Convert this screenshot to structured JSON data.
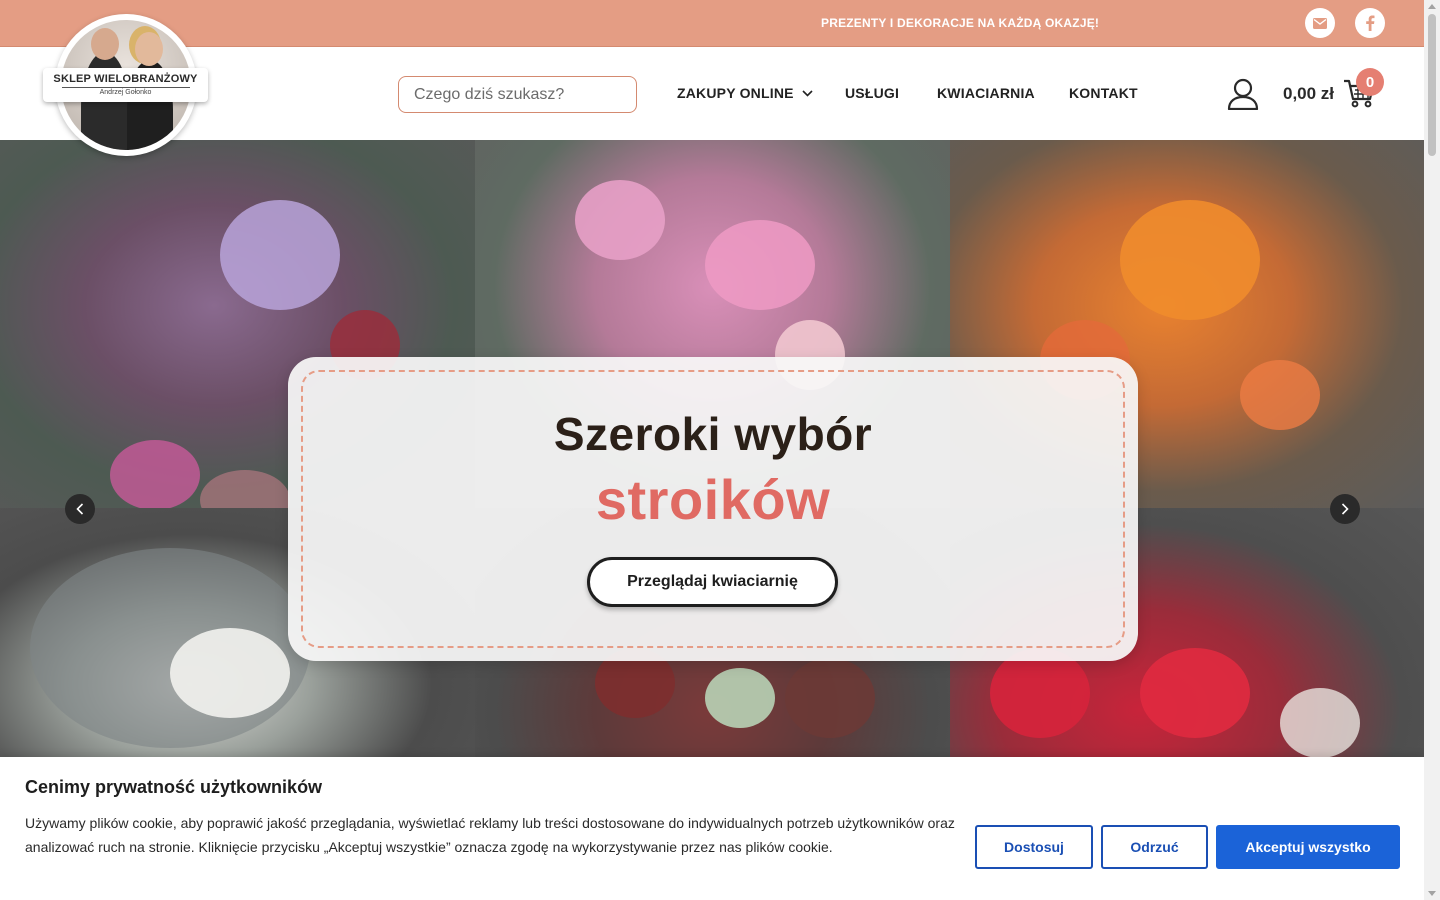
{
  "topbar": {
    "text": "PREZENTY I DEKORACJE NA KAŻDĄ OKAZJĘ!",
    "background": "#e49d84",
    "social": [
      {
        "icon": "mail-icon"
      },
      {
        "icon": "facebook-icon"
      }
    ]
  },
  "logo": {
    "title": "SKLEP WIELOBRANŻOWY",
    "subtitle": "Andrzej Gołonko"
  },
  "search": {
    "placeholder": "Czego dziś szukasz?"
  },
  "nav": {
    "items": [
      {
        "label": "ZAKUPY ONLINE",
        "has_dropdown": true
      },
      {
        "label": "USŁUGI"
      },
      {
        "label": "KWIACIARNIA"
      },
      {
        "label": "KONTAKT"
      }
    ]
  },
  "cart": {
    "total": "0,00 zł",
    "count": "0",
    "badge_color": "#e57f72"
  },
  "hero": {
    "line1": "Szeroki wybór",
    "line2": "stroików",
    "button_label": "Przeglądaj kwiaciarnię",
    "accent": "#e06a63",
    "border_color": "#e69c86"
  },
  "cookie": {
    "title": "Cenimy prywatność użytkowników",
    "text": "Używamy plików cookie, aby poprawić jakość przeglądania, wyświetlać reklamy lub treści dostosowane do indywidualnych potrzeb użytkowników oraz analizować ruch na stronie. Kliknięcie przycisku „Akceptuj wszystkie” oznacza zgodę na wykorzystywanie przez nas plików cookie.",
    "btn_customize": "Dostosuj",
    "btn_reject": "Odrzuć",
    "btn_accept": "Akceptuj wszystko",
    "primary_color": "#1b63d8"
  }
}
